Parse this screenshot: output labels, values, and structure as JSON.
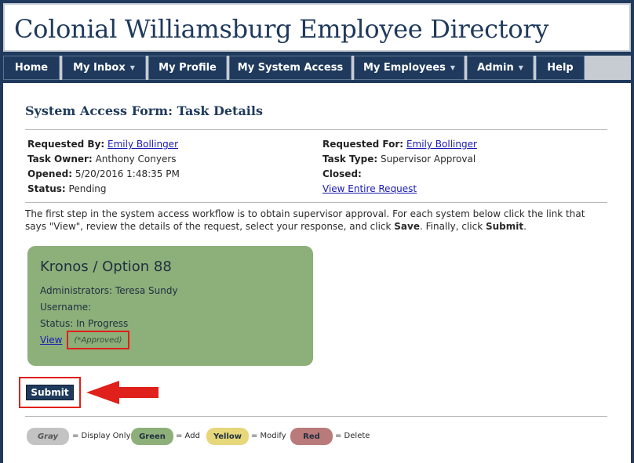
{
  "header": {
    "title": "Colonial Williamsburg Employee Directory"
  },
  "nav": [
    {
      "label": "Home",
      "dropdown": false
    },
    {
      "label": "My Inbox",
      "dropdown": true
    },
    {
      "label": "My Profile",
      "dropdown": false
    },
    {
      "label": "My System Access",
      "dropdown": false
    },
    {
      "label": "My Employees",
      "dropdown": true
    },
    {
      "label": "Admin",
      "dropdown": true
    },
    {
      "label": "Help",
      "dropdown": false
    }
  ],
  "page": {
    "title": "System Access Form: Task Details"
  },
  "details": {
    "requested_by_label": "Requested By:",
    "requested_by": "Emily Bollinger",
    "task_owner_label": "Task Owner:",
    "task_owner": "Anthony Conyers",
    "opened_label": "Opened:",
    "opened": "5/20/2016 1:48:35 PM",
    "status_label": "Status:",
    "status": "Pending",
    "requested_for_label": "Requested For:",
    "requested_for": "Emily Bollinger",
    "task_type_label": "Task Type:",
    "task_type": "Supervisor Approval",
    "closed_label": "Closed:",
    "closed": "",
    "view_request_link": "View Entire Request"
  },
  "instructions": {
    "text1": "The first step in the system access workflow is to obtain supervisor approval. For each system below click the link that says \"View\", review the details of the request, select your response, and click ",
    "save": "Save",
    "text2": ". Finally, click ",
    "submit": "Submit",
    "text3": "."
  },
  "card": {
    "title": "Kronos / Option 88",
    "administrators": "Administrators: Teresa Sundy",
    "username": "Username:",
    "status": "Status: In Progress",
    "view_link": "View",
    "approved": "(*Approved)",
    "color": "#8daf7a"
  },
  "submit_label": "Submit",
  "legend": [
    {
      "name": "Gray",
      "desc": "= Display Only",
      "color": "#c3c3c3",
      "text_color": "#555555"
    },
    {
      "name": "Green",
      "desc": "= Add",
      "color": "#8daf7a",
      "text_color": "#1f2f40"
    },
    {
      "name": "Yellow",
      "desc": "= Modify",
      "color": "#e6d77a",
      "text_color": "#1f2f40"
    },
    {
      "name": "Red",
      "desc": "= Delete",
      "color": "#b97a7a",
      "text_color": "#1f2f40"
    }
  ],
  "colors": {
    "brand": "#1f3a5c",
    "highlight": "#e0201a"
  }
}
